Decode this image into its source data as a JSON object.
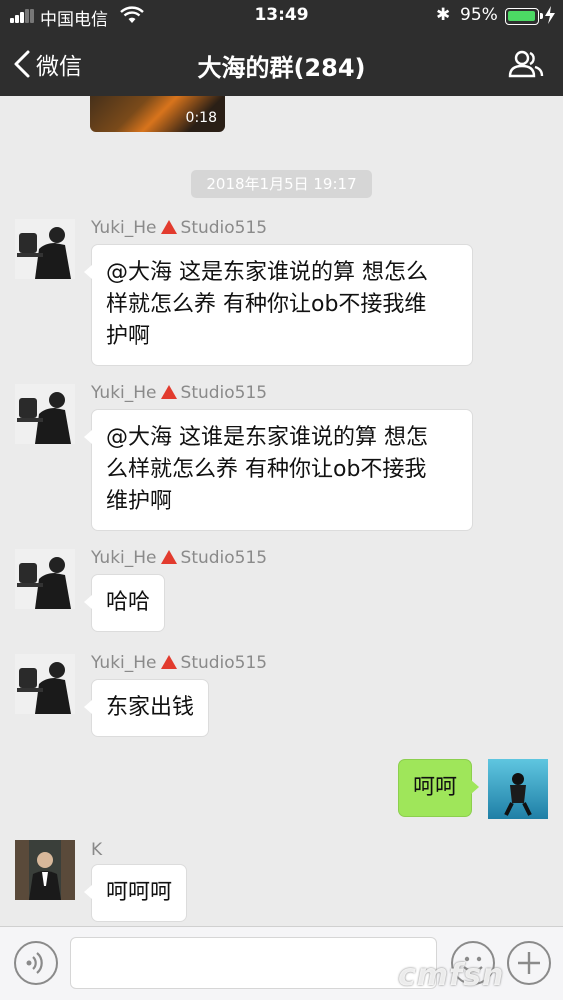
{
  "status": {
    "carrier": "中国电信",
    "time": "13:49",
    "battery_pct": "95%",
    "battery_color": "#4cd964",
    "icons": [
      "signal-icon",
      "wifi-icon",
      "bluetooth-icon",
      "battery-icon",
      "charging-bolt-icon"
    ]
  },
  "nav": {
    "back_label": "微信",
    "title": "大海的群(284)",
    "right_icon": "group-members-icon"
  },
  "chat": {
    "video": {
      "duration": "0:18"
    },
    "timestamp": "2018年1月5日 19:17",
    "messages": [
      {
        "sender": "Yuki_He",
        "sender_suffix": "Studio515",
        "text_lines": [
          "@大海 这是东家谁说的算 想怎么",
          "样就怎么养 有种你让ob不接我维",
          "护啊"
        ]
      },
      {
        "sender": "Yuki_He",
        "sender_suffix": "Studio515",
        "text_lines": [
          "@大海 这谁是东家谁说的算 想怎",
          "么样就怎么养 有种你让ob不接我",
          "维护啊"
        ]
      },
      {
        "sender": "Yuki_He",
        "sender_suffix": "Studio515",
        "text": "哈哈"
      },
      {
        "sender": "Yuki_He",
        "sender_suffix": "Studio515",
        "text": "东家出钱"
      },
      {
        "sender": "",
        "text": "呵呵",
        "outgoing": true
      },
      {
        "sender": "K",
        "text": "呵呵呵"
      }
    ]
  },
  "inputbar": {
    "icons": [
      "voice-icon",
      "emoji-icon",
      "plus-icon"
    ]
  },
  "watermark": "cmfsn",
  "colors": {
    "nav_bg": "#2e2e2e",
    "chat_bg": "#ebebeb",
    "outgoing_bubble": "#9fe65a",
    "badge_red": "#e23b2e"
  }
}
